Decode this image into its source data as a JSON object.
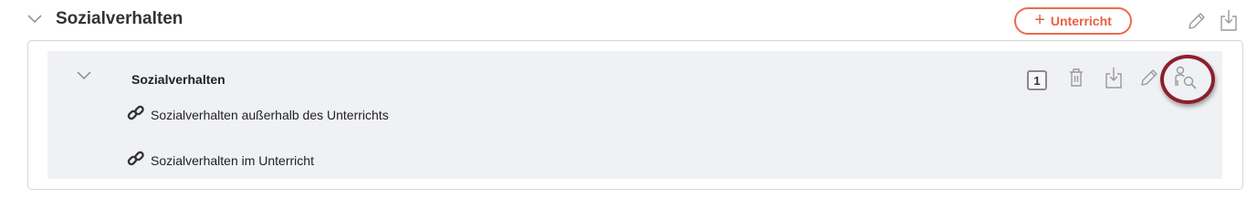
{
  "section": {
    "title": "Sozialverhalten",
    "add_button_label": "Unterricht",
    "add_button_icon": "plus-icon"
  },
  "group": {
    "title": "Sozialverhalten",
    "count": "1",
    "items": [
      {
        "label": "Sozialverhalten außerhalb des Unterrichts",
        "icon": "link-icon"
      },
      {
        "label": "Sozialverhalten im Unterricht",
        "icon": "link-icon"
      }
    ]
  },
  "colors": {
    "accent": "#e8603f",
    "highlight_ring": "#8d1f2c",
    "panel_bg": "#f0f1f4"
  }
}
